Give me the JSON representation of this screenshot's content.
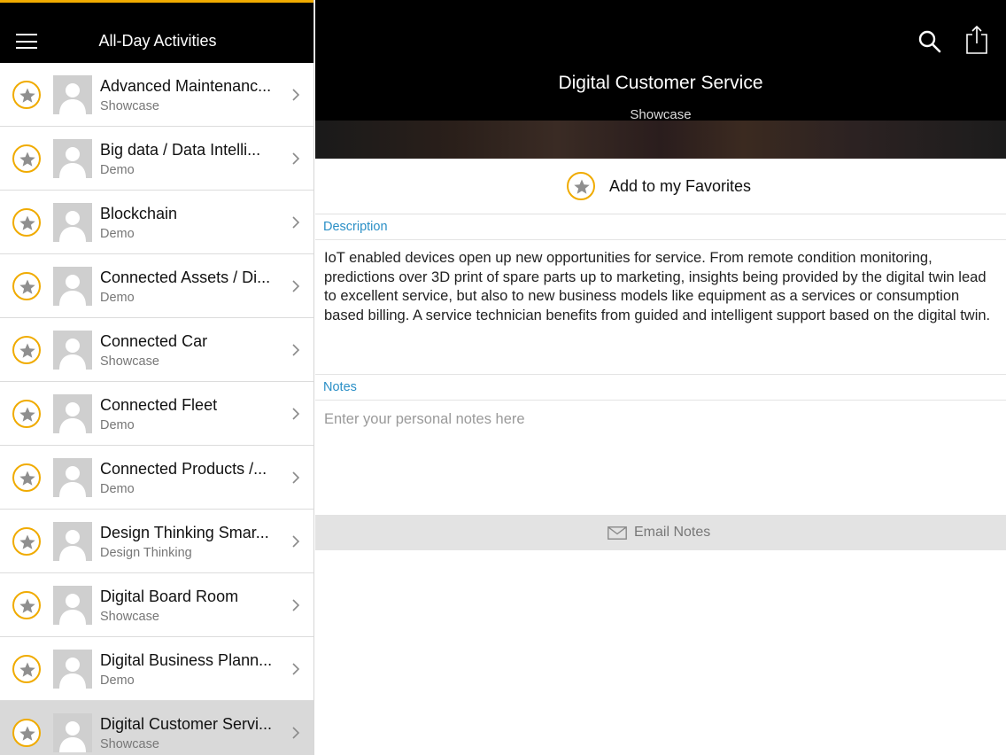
{
  "sidebar": {
    "title": "All-Day Activities",
    "items": [
      {
        "title": "Advanced Maintenanc...",
        "subtitle": "Showcase"
      },
      {
        "title": "Big data / Data Intelli...",
        "subtitle": "Demo"
      },
      {
        "title": "Blockchain",
        "subtitle": "Demo"
      },
      {
        "title": "Connected Assets / Di...",
        "subtitle": "Demo"
      },
      {
        "title": "Connected Car",
        "subtitle": "Showcase"
      },
      {
        "title": "Connected Fleet",
        "subtitle": "Demo"
      },
      {
        "title": "Connected Products /...",
        "subtitle": "Demo"
      },
      {
        "title": "Design Thinking Smar...",
        "subtitle": "Design Thinking"
      },
      {
        "title": "Digital Board Room",
        "subtitle": "Showcase"
      },
      {
        "title": "Digital Business Plann...",
        "subtitle": "Demo"
      },
      {
        "title": "Digital Customer Servi...",
        "subtitle": "Showcase"
      }
    ]
  },
  "detail": {
    "title": "Digital Customer Service",
    "subtitle": "Showcase",
    "favorites_label": "Add to my Favorites",
    "description_label": "Description",
    "description": "IoT enabled devices open up new opportunities for service. From remote condition monitoring, predictions over 3D print of spare parts up to marketing, insights being provided by the digital twin lead to excellent service, but also to new business models like equipment as a services or consumption based billing. A service technician benefits from guided and intelligent support based on the digital twin.",
    "notes_label": "Notes",
    "notes_placeholder": "Enter your personal notes here",
    "notes_value": "",
    "email_label": "Email Notes"
  },
  "colors": {
    "accent": "#f0ab00",
    "header_bg": "#000000",
    "section_label": "#2a8fc6",
    "selected_row": "#d9d9d9"
  },
  "icons": {
    "menu": "hamburger-icon",
    "search": "search-icon",
    "share": "share-icon",
    "favorite": "star-icon",
    "chevron": "chevron-right-icon",
    "email": "envelope-icon",
    "thumbnail": "person-placeholder-icon"
  }
}
